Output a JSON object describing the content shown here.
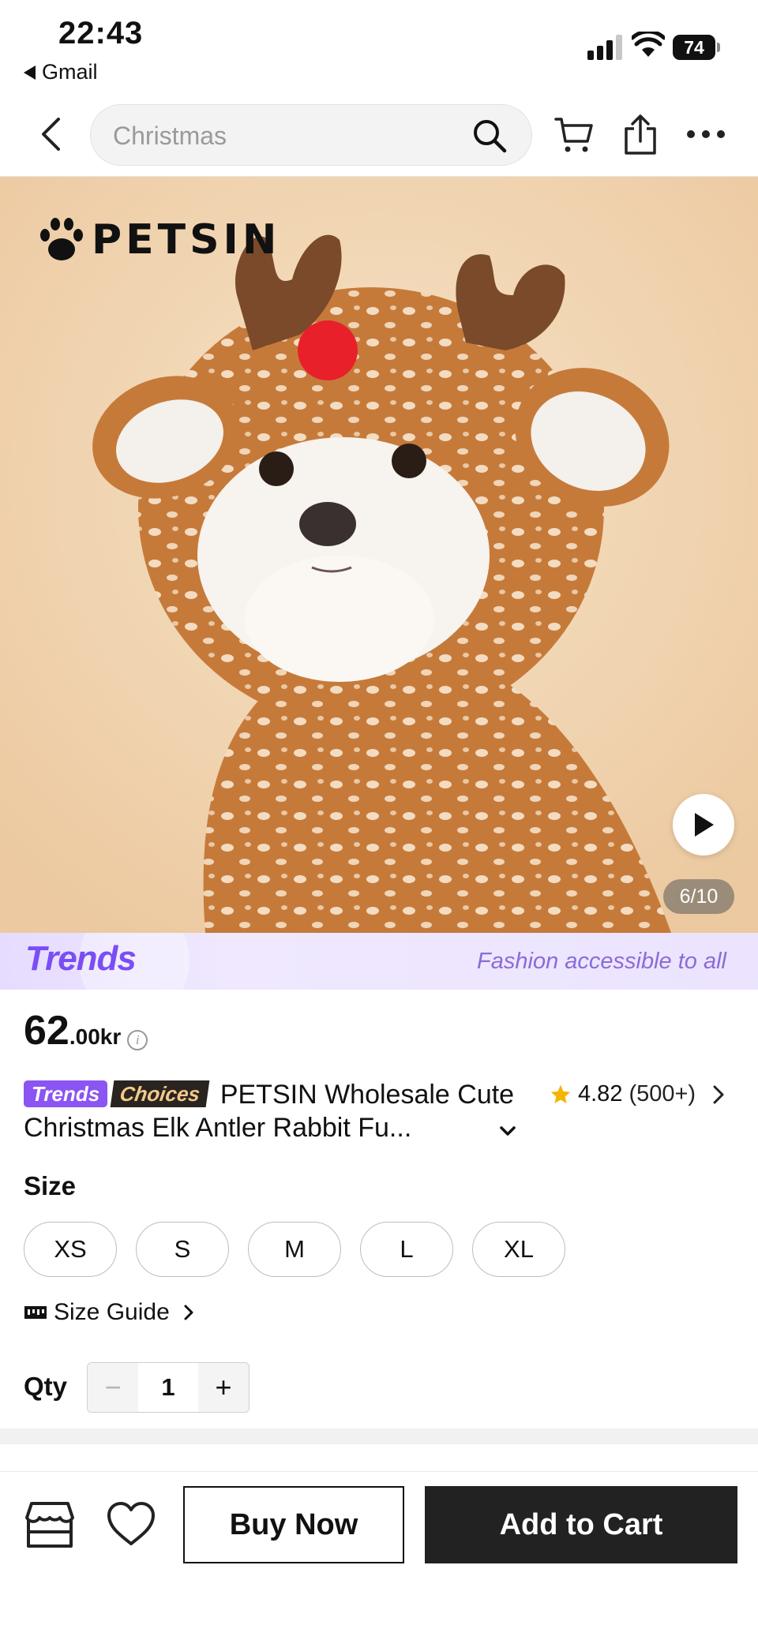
{
  "status_bar": {
    "time": "22:43",
    "back_app": "Gmail",
    "battery": "74"
  },
  "header": {
    "search_placeholder": "Christmas",
    "icons": [
      "back-arrow-icon",
      "search-icon",
      "cart-icon",
      "share-icon",
      "more-icon"
    ]
  },
  "gallery": {
    "brand_logo": "PETSIN",
    "page_indicator": "6/10",
    "icons": [
      "paw-icon",
      "play-icon"
    ]
  },
  "banner": {
    "logo": "Trends",
    "tagline": "Fashion accessible to all",
    "colors": {
      "background": "#ece4ff",
      "accent": "#7a4df5"
    }
  },
  "price": {
    "integer": "62",
    "decimal": ".00",
    "currency": "kr"
  },
  "product": {
    "badge_trends": "Trends",
    "badge_choices": "Choices",
    "title": "PETSIN Wholesale Cute Christmas Elk Antler Rabbit Fu...",
    "rating": "4.82",
    "review_count": "(500+)"
  },
  "size": {
    "label": "Size",
    "options": [
      "XS",
      "S",
      "M",
      "L",
      "XL"
    ],
    "guide_label": "Size Guide"
  },
  "quantity": {
    "label": "Qty",
    "value": "1",
    "minus": "−",
    "plus": "+"
  },
  "actions": {
    "buy_now": "Buy Now",
    "add_to_cart": "Add to Cart",
    "colors": {
      "primary": "#222222"
    }
  }
}
